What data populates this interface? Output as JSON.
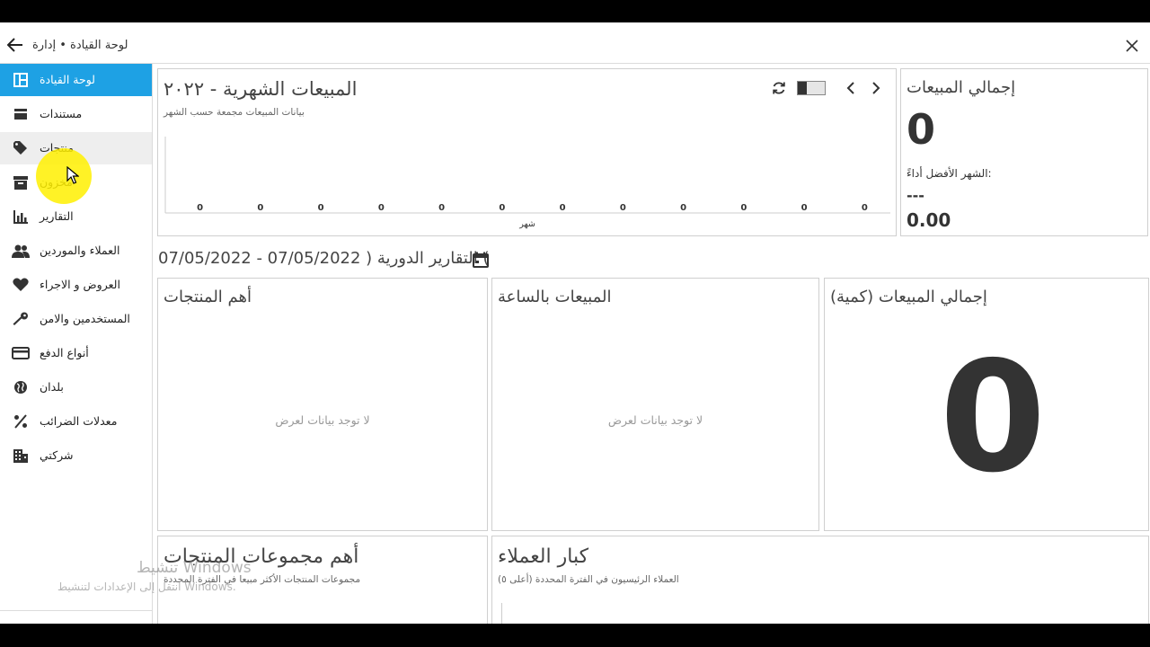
{
  "titlebar": {
    "breadcrumb": "لوحة القيادة • إدارة"
  },
  "sidebar": {
    "items": [
      {
        "label": "لوحة القيادة",
        "icon": "dashboard-icon",
        "state": "active"
      },
      {
        "label": "مستندات",
        "icon": "documents-icon",
        "state": "normal"
      },
      {
        "label": "منتجات",
        "icon": "tag-icon",
        "state": "hover"
      },
      {
        "label": "مخزون",
        "icon": "archive-icon",
        "state": "normal"
      },
      {
        "label": "التقارير",
        "icon": "bar-chart-icon",
        "state": "normal"
      },
      {
        "label": "العملاء والموردين",
        "icon": "users-icon",
        "state": "normal"
      },
      {
        "label": "العروض و الاجراء",
        "icon": "heart-icon",
        "state": "normal"
      },
      {
        "label": "المستخدمين والامن",
        "icon": "key-icon",
        "state": "normal"
      },
      {
        "label": "أنواع الدفع",
        "icon": "credit-card-icon",
        "state": "normal"
      },
      {
        "label": "بلدان",
        "icon": "globe-icon",
        "state": "normal"
      },
      {
        "label": "معدلات الضرائب",
        "icon": "percent-icon",
        "state": "normal"
      },
      {
        "label": "شركتي",
        "icon": "building-icon",
        "state": "normal"
      }
    ]
  },
  "monthly": {
    "title": "المبيعات الشهرية - ٢٠٢٢",
    "subtitle": "بيانات المبيعات مجمعة حسب الشهر"
  },
  "chart_data": {
    "type": "bar",
    "title": "المبيعات الشهرية - ٢٠٢٢",
    "subtitle": "بيانات المبيعات مجمعة حسب الشهر",
    "xlabel": "شهر",
    "ylabel": "",
    "categories": [
      "",
      "",
      "",
      "",
      "",
      "",
      "",
      "",
      "",
      "",
      "",
      ""
    ],
    "values": [
      0,
      0,
      0,
      0,
      0,
      0,
      0,
      0,
      0,
      0,
      0,
      0
    ],
    "data_labels": [
      "0",
      "0",
      "0",
      "0",
      "0",
      "0",
      "0",
      "0",
      "0",
      "0",
      "0",
      "0"
    ],
    "grid": false,
    "legend": "none"
  },
  "total": {
    "title": "إجمالي المبيعات",
    "value": "0",
    "best_label": "الشهر الأفضل أداءً:",
    "best_month": "---",
    "best_amount": "0.00"
  },
  "period": {
    "text": "07/05/2022 - 07/05/2022 ) التقارير الدورية ("
  },
  "panels": {
    "top_products": {
      "title": "أهم المنتجات",
      "empty": "لا توجد بيانات لعرض"
    },
    "hourly": {
      "title": "المبيعات بالساعة",
      "empty": "لا توجد بيانات لعرض"
    },
    "quantity": {
      "title": "(إجمالي المبيعات (كمية",
      "value": "0"
    },
    "groups": {
      "title": "أهم مجموعات المنتجات",
      "subtitle": "مجموعات المنتجات الأكثر مبيعا في الفترة المحددة"
    },
    "customers": {
      "title": "كبار العملاء",
      "subtitle": "(العملاء الرئيسيون في الفترة المحددة (أعلى ٥"
    }
  },
  "watermark": {
    "title": "تنشيط Windows",
    "subtitle": "انتقل إلى الإعدادات لتنشيط Windows."
  },
  "colors": {
    "accent": "#1ea1e4",
    "hover": "#eeeeee",
    "cursor_highlight": "#fff000"
  }
}
